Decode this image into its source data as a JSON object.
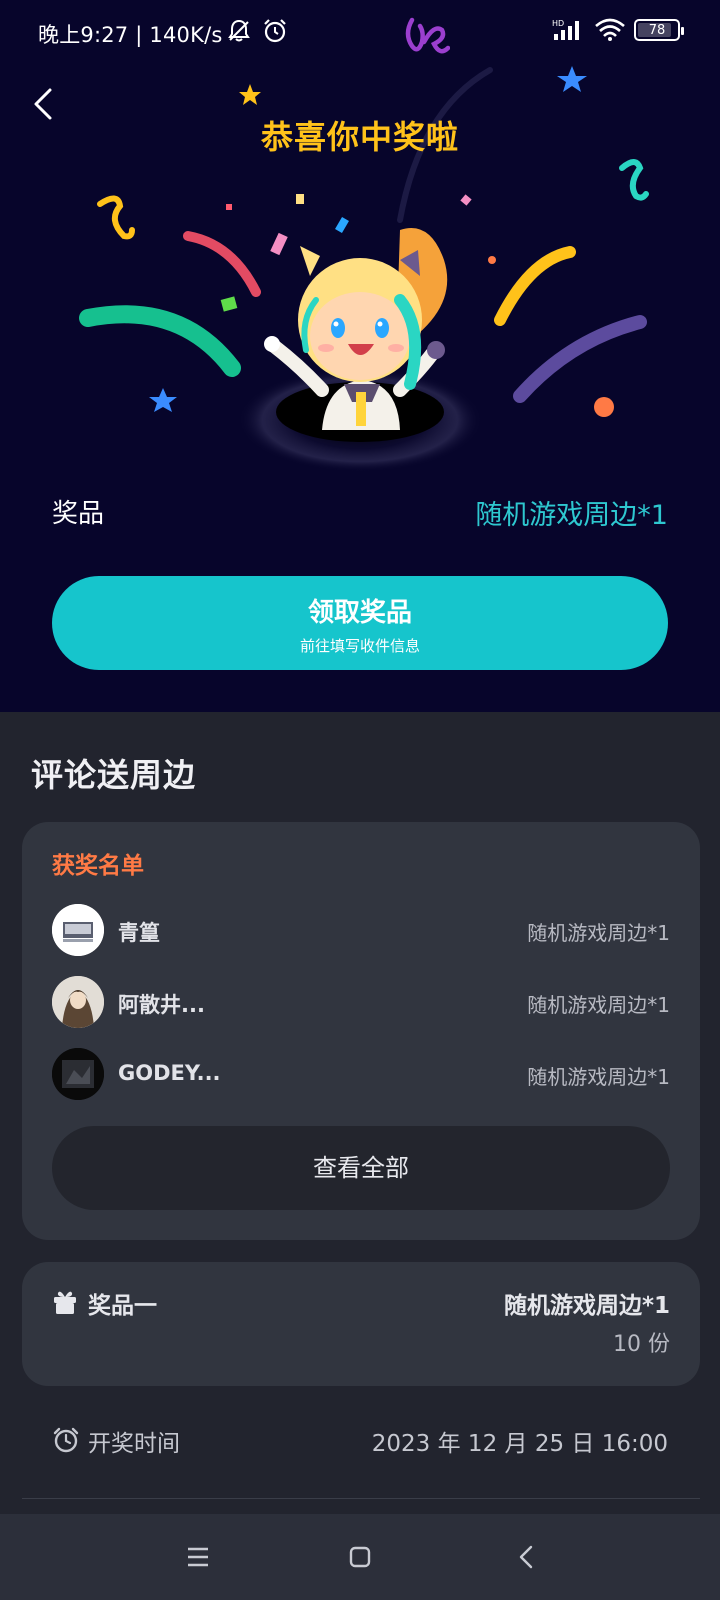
{
  "status_bar": {
    "time": "晚上9:27",
    "separator": "|",
    "speed": "140K/s",
    "battery": "78",
    "signal_badge": "HD",
    "icons": [
      "mute-bell-icon",
      "alarm-icon",
      "signal-icon",
      "wifi-icon",
      "battery-icon"
    ]
  },
  "header": {
    "title": "恭喜你中奖啦",
    "back_icon": "back-chevron-icon"
  },
  "prize": {
    "label": "奖品",
    "value": "随机游戏周边*1"
  },
  "claim_button": {
    "label": "领取奖品",
    "sublabel": "前往填写收件信息"
  },
  "section": {
    "title": "评论送周边"
  },
  "winners": {
    "title": "获奖名单",
    "items": [
      {
        "name": "青篁",
        "prize": "随机游戏周边*1"
      },
      {
        "name": "阿散井...",
        "prize": "随机游戏周边*1"
      },
      {
        "name": "GODEY...",
        "prize": "随机游戏周边*1"
      }
    ],
    "view_all_label": "查看全部"
  },
  "prize_tier": {
    "icon": "gift-icon",
    "label": "奖品一",
    "value": "随机游戏周边*1",
    "count": "10 份"
  },
  "draw_time": {
    "icon": "alarm-clock-icon",
    "label": "开奖时间",
    "value": "2023 年 12 月 25 日 16:00"
  },
  "colors": {
    "hero_background": "#07052b",
    "title_gold": "#ffc21a",
    "accent_teal": "#16c5cc",
    "winners_title_orange": "#ff7a45",
    "card_background": "#31353f",
    "page_background": "#22242e"
  },
  "nav_bar": {
    "icons": [
      "menu-icon",
      "home-square-icon",
      "back-triangle-icon"
    ]
  }
}
